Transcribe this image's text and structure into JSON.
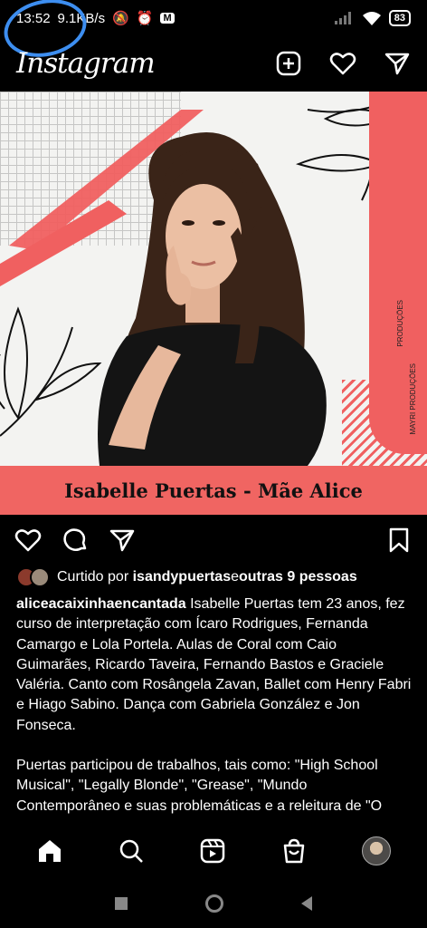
{
  "status_bar": {
    "time": "13:52",
    "speed": "9.1KB/s",
    "battery": "83",
    "mail_badge": "M"
  },
  "header": {
    "logo": "Instagram"
  },
  "post": {
    "image_caption": "Isabelle Puertas - Mãe Alice",
    "brand_vertical": "PRODUÇÕES",
    "brand_vertical2": "MAYRI PRODUÇÕES",
    "likes_prefix": "Curtido por ",
    "likes_user": "isandypuertas",
    "likes_mid": " e ",
    "likes_rest": "outras 9 pessoas",
    "author": "aliceacaixinhaencantada",
    "caption_p1": " Isabelle Puertas tem 23 anos, fez curso de interpretação com Ícaro Rodrigues, Fernanda Camargo e Lola Portela. Aulas de Coral com Caio Guimarães, Ricardo Taveira, Fernando Bastos e Graciele Valéria. Canto com Rosângela Zavan, Ballet com Henry Fabri e Hiago Sabino. Dança com Gabriela González e Jon Fonseca.",
    "caption_p2": "Puertas participou de trabalhos, tais como: \"High School Musical\", \"Legally Blonde\", \"Grease\", \"Mundo Contemporâneo e suas problemáticas e a releitura de \"O"
  },
  "colors": {
    "accent_red": "#f06060",
    "annotation_blue": "#3d8ef0"
  }
}
